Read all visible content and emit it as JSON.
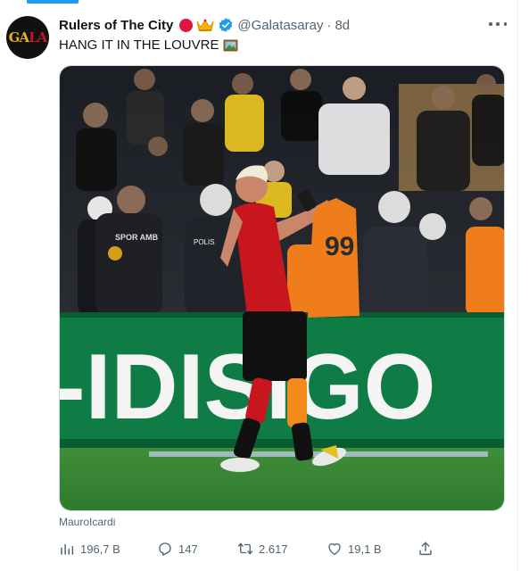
{
  "tweet": {
    "display_name": "Rulers of The City",
    "handle": "@Galatasaray",
    "separator": "·",
    "time_ago": "8d",
    "text": "HANG IT IN THE LOUVRE",
    "avatar_text_a": "GA",
    "avatar_text_b": "LA",
    "media_tag": "MauroIcardi",
    "photo_ad_board": "-IDISIGO",
    "photo_jersey_number": "99"
  },
  "actions": {
    "views": "196,7 B",
    "replies": "147",
    "retweets": "2.617",
    "likes": "19,1 B"
  },
  "colors": {
    "accent": "#1d9bf0",
    "verified": "#1d9bf0",
    "muted_text": "#536471",
    "jersey_orange": "#f07d1c",
    "board_green": "#0f7b45"
  },
  "icons": {
    "more": "more-horizontal-icon",
    "verified": "verified-badge-icon",
    "views": "bar-chart-icon",
    "reply": "speech-bubble-icon",
    "retweet": "retweet-icon",
    "like": "heart-icon",
    "share": "share-upload-icon"
  }
}
